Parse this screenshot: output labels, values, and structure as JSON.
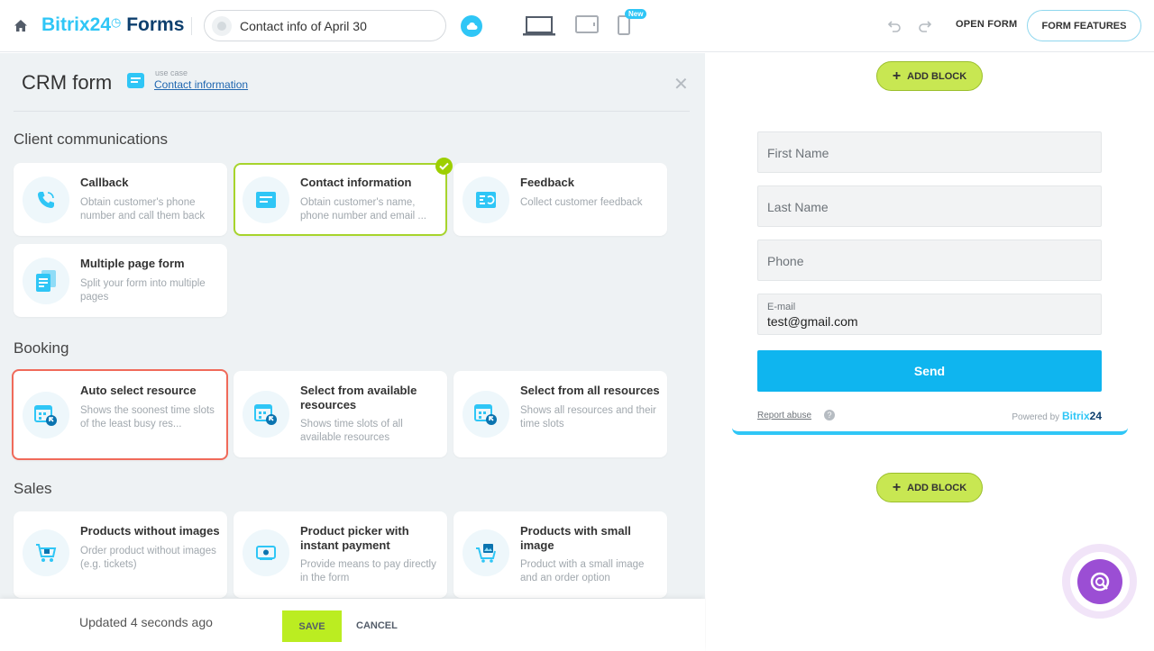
{
  "header": {
    "brand_part1": "Bitrix24",
    "brand_part2": "Forms",
    "form_title": "Contact info of April 30",
    "new_badge": "New",
    "open_form": "OPEN FORM",
    "form_features": "FORM FEATURES"
  },
  "panel": {
    "title": "CRM form",
    "usecase_label": "use case",
    "usecase_link": "Contact information"
  },
  "sections": {
    "client": "Client communications",
    "booking": "Booking",
    "sales": "Sales"
  },
  "cards": {
    "callback": {
      "title": "Callback",
      "desc": "Obtain customer's phone number and call them back",
      "icon": "phone-icon"
    },
    "contact": {
      "title": "Contact information",
      "desc": "Obtain customer's name, phone number and email ...",
      "icon": "form-icon"
    },
    "feedback": {
      "title": "Feedback",
      "desc": "Collect customer feedback",
      "icon": "feedback-icon"
    },
    "multipage": {
      "title": "Multiple page form",
      "desc": "Split your form into multiple pages",
      "icon": "pages-icon"
    },
    "auto_select": {
      "title": "Auto select resource",
      "desc": "Shows the soonest time slots of the least busy res...",
      "icon": "calendar-icon"
    },
    "select_available": {
      "title": "Select from available resources",
      "desc": "Shows time slots of all available resources",
      "icon": "calendar-icon"
    },
    "select_all": {
      "title": "Select from all resources",
      "desc": "Shows all resources and their time slots",
      "icon": "calendar-icon"
    },
    "products_no_img": {
      "title": "Products without images",
      "desc": "Order product without images (e.g. tickets)",
      "icon": "cart-icon"
    },
    "product_picker": {
      "title": "Product picker with instant payment",
      "desc": "Provide means to pay directly in the form",
      "icon": "payment-icon"
    },
    "products_small": {
      "title": "Products with small image",
      "desc": "Product with a small image and an order option",
      "icon": "image-cart-icon"
    }
  },
  "footer": {
    "updated": "Updated 4 seconds ago",
    "save": "SAVE",
    "cancel": "CANCEL"
  },
  "preview": {
    "add_block": "ADD BLOCK",
    "first_name": "First Name",
    "last_name": "Last Name",
    "phone": "Phone",
    "email_label": "E-mail",
    "email_value": "test@gmail.com",
    "send": "Send",
    "report_abuse": "Report abuse",
    "help": "?",
    "powered_by": "Powered by",
    "powered_brand1": "Bitrix",
    "powered_brand2": "24"
  },
  "colors": {
    "accent_blue": "#2fc6f6",
    "green": "#bbed21",
    "selected_green": "#a7d42c",
    "selected_red": "#f06a5a",
    "send_blue": "#0fb5ef"
  }
}
